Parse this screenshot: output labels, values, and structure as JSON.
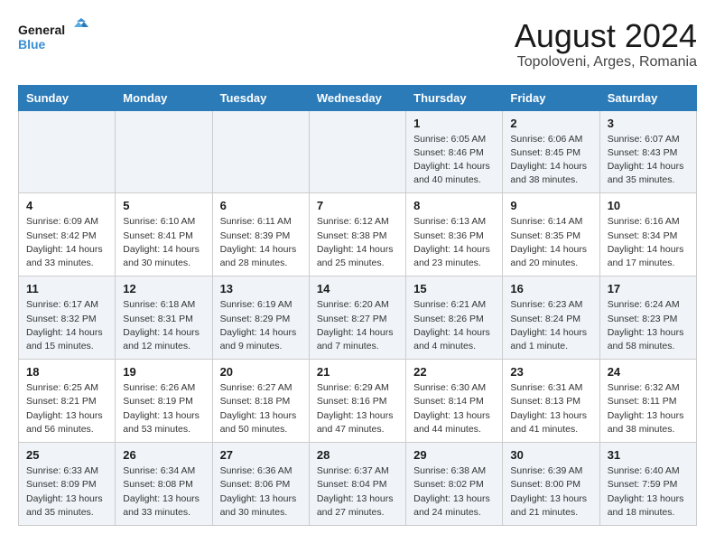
{
  "header": {
    "logo_line1": "General",
    "logo_line2": "Blue",
    "title": "August 2024",
    "subtitle": "Topoloveni, Arges, Romania"
  },
  "weekdays": [
    "Sunday",
    "Monday",
    "Tuesday",
    "Wednesday",
    "Thursday",
    "Friday",
    "Saturday"
  ],
  "weeks": [
    [
      {
        "day": "",
        "info": ""
      },
      {
        "day": "",
        "info": ""
      },
      {
        "day": "",
        "info": ""
      },
      {
        "day": "",
        "info": ""
      },
      {
        "day": "1",
        "info": "Sunrise: 6:05 AM\nSunset: 8:46 PM\nDaylight: 14 hours\nand 40 minutes."
      },
      {
        "day": "2",
        "info": "Sunrise: 6:06 AM\nSunset: 8:45 PM\nDaylight: 14 hours\nand 38 minutes."
      },
      {
        "day": "3",
        "info": "Sunrise: 6:07 AM\nSunset: 8:43 PM\nDaylight: 14 hours\nand 35 minutes."
      }
    ],
    [
      {
        "day": "4",
        "info": "Sunrise: 6:09 AM\nSunset: 8:42 PM\nDaylight: 14 hours\nand 33 minutes."
      },
      {
        "day": "5",
        "info": "Sunrise: 6:10 AM\nSunset: 8:41 PM\nDaylight: 14 hours\nand 30 minutes."
      },
      {
        "day": "6",
        "info": "Sunrise: 6:11 AM\nSunset: 8:39 PM\nDaylight: 14 hours\nand 28 minutes."
      },
      {
        "day": "7",
        "info": "Sunrise: 6:12 AM\nSunset: 8:38 PM\nDaylight: 14 hours\nand 25 minutes."
      },
      {
        "day": "8",
        "info": "Sunrise: 6:13 AM\nSunset: 8:36 PM\nDaylight: 14 hours\nand 23 minutes."
      },
      {
        "day": "9",
        "info": "Sunrise: 6:14 AM\nSunset: 8:35 PM\nDaylight: 14 hours\nand 20 minutes."
      },
      {
        "day": "10",
        "info": "Sunrise: 6:16 AM\nSunset: 8:34 PM\nDaylight: 14 hours\nand 17 minutes."
      }
    ],
    [
      {
        "day": "11",
        "info": "Sunrise: 6:17 AM\nSunset: 8:32 PM\nDaylight: 14 hours\nand 15 minutes."
      },
      {
        "day": "12",
        "info": "Sunrise: 6:18 AM\nSunset: 8:31 PM\nDaylight: 14 hours\nand 12 minutes."
      },
      {
        "day": "13",
        "info": "Sunrise: 6:19 AM\nSunset: 8:29 PM\nDaylight: 14 hours\nand 9 minutes."
      },
      {
        "day": "14",
        "info": "Sunrise: 6:20 AM\nSunset: 8:27 PM\nDaylight: 14 hours\nand 7 minutes."
      },
      {
        "day": "15",
        "info": "Sunrise: 6:21 AM\nSunset: 8:26 PM\nDaylight: 14 hours\nand 4 minutes."
      },
      {
        "day": "16",
        "info": "Sunrise: 6:23 AM\nSunset: 8:24 PM\nDaylight: 14 hours\nand 1 minute."
      },
      {
        "day": "17",
        "info": "Sunrise: 6:24 AM\nSunset: 8:23 PM\nDaylight: 13 hours\nand 58 minutes."
      }
    ],
    [
      {
        "day": "18",
        "info": "Sunrise: 6:25 AM\nSunset: 8:21 PM\nDaylight: 13 hours\nand 56 minutes."
      },
      {
        "day": "19",
        "info": "Sunrise: 6:26 AM\nSunset: 8:19 PM\nDaylight: 13 hours\nand 53 minutes."
      },
      {
        "day": "20",
        "info": "Sunrise: 6:27 AM\nSunset: 8:18 PM\nDaylight: 13 hours\nand 50 minutes."
      },
      {
        "day": "21",
        "info": "Sunrise: 6:29 AM\nSunset: 8:16 PM\nDaylight: 13 hours\nand 47 minutes."
      },
      {
        "day": "22",
        "info": "Sunrise: 6:30 AM\nSunset: 8:14 PM\nDaylight: 13 hours\nand 44 minutes."
      },
      {
        "day": "23",
        "info": "Sunrise: 6:31 AM\nSunset: 8:13 PM\nDaylight: 13 hours\nand 41 minutes."
      },
      {
        "day": "24",
        "info": "Sunrise: 6:32 AM\nSunset: 8:11 PM\nDaylight: 13 hours\nand 38 minutes."
      }
    ],
    [
      {
        "day": "25",
        "info": "Sunrise: 6:33 AM\nSunset: 8:09 PM\nDaylight: 13 hours\nand 35 minutes."
      },
      {
        "day": "26",
        "info": "Sunrise: 6:34 AM\nSunset: 8:08 PM\nDaylight: 13 hours\nand 33 minutes."
      },
      {
        "day": "27",
        "info": "Sunrise: 6:36 AM\nSunset: 8:06 PM\nDaylight: 13 hours\nand 30 minutes."
      },
      {
        "day": "28",
        "info": "Sunrise: 6:37 AM\nSunset: 8:04 PM\nDaylight: 13 hours\nand 27 minutes."
      },
      {
        "day": "29",
        "info": "Sunrise: 6:38 AM\nSunset: 8:02 PM\nDaylight: 13 hours\nand 24 minutes."
      },
      {
        "day": "30",
        "info": "Sunrise: 6:39 AM\nSunset: 8:00 PM\nDaylight: 13 hours\nand 21 minutes."
      },
      {
        "day": "31",
        "info": "Sunrise: 6:40 AM\nSunset: 7:59 PM\nDaylight: 13 hours\nand 18 minutes."
      }
    ]
  ]
}
